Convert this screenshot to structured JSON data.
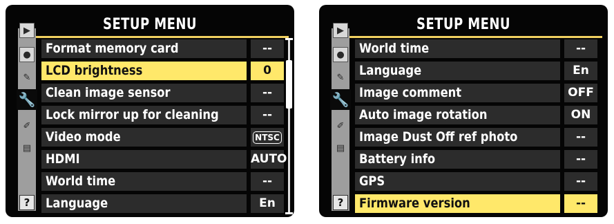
{
  "screens": [
    {
      "title": "SETUP MENU",
      "items": [
        {
          "label": "Format memory card",
          "value": "--"
        },
        {
          "label": "LCD brightness",
          "value": "0",
          "selected": true
        },
        {
          "label": "Clean image sensor",
          "value": "--"
        },
        {
          "label": "Lock mirror up for cleaning",
          "value": "--"
        },
        {
          "label": "Video mode",
          "value": "NTSC",
          "boxed": true
        },
        {
          "label": "HDMI",
          "value": "AUTO"
        },
        {
          "label": "World time",
          "value": "--"
        },
        {
          "label": "Language",
          "value": "En"
        }
      ],
      "scrollbar": true
    },
    {
      "title": "SETUP MENU",
      "items": [
        {
          "label": "World time",
          "value": "--"
        },
        {
          "label": "Language",
          "value": "En"
        },
        {
          "label": "Image comment",
          "value": "OFF"
        },
        {
          "label": "Auto image rotation",
          "value": "ON"
        },
        {
          "label": "Image Dust Off ref photo",
          "value": "--"
        },
        {
          "label": "Battery info",
          "value": "--"
        },
        {
          "label": "GPS",
          "value": "--"
        },
        {
          "label": "Firmware version",
          "value": "--",
          "selected": true
        }
      ],
      "scrollbar": false
    }
  ],
  "sidebar_icons": [
    {
      "name": "playback-menu-icon",
      "glyph": "▶"
    },
    {
      "name": "shooting-menu-icon",
      "glyph": "●"
    },
    {
      "name": "custom-settings-icon",
      "glyph": "✎"
    },
    {
      "name": "setup-menu-icon",
      "glyph": "🔧",
      "active": true
    },
    {
      "name": "retouch-menu-icon",
      "glyph": "✐"
    },
    {
      "name": "my-menu-icon",
      "glyph": "▤"
    },
    {
      "name": "help-icon",
      "glyph": "?"
    }
  ],
  "colors": {
    "selected_row": "#ffe86a",
    "row": "#2c2c2c",
    "accent": "#f0d060",
    "sidebar": "#9e9e9e"
  }
}
